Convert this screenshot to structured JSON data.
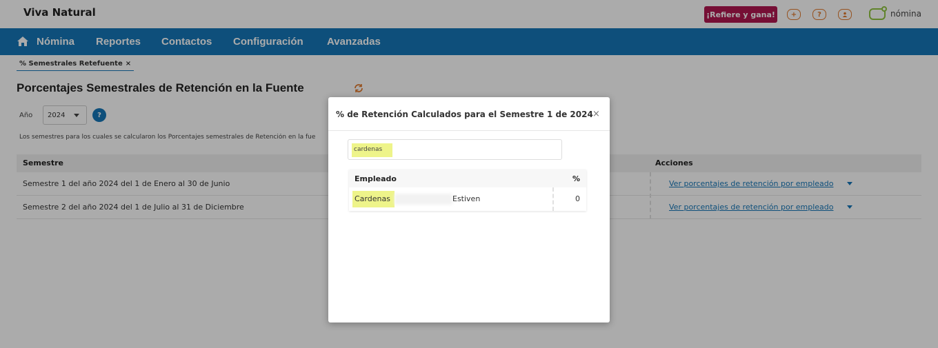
{
  "header": {
    "company": "Viva Natural",
    "refiere_label": "¡Refiere y gana!",
    "icons": [
      "plus-icon",
      "question-icon",
      "user-icon"
    ],
    "logo_text": "nómina"
  },
  "nav": {
    "items": [
      "Nómina",
      "Reportes",
      "Contactos",
      "Configuración",
      "Avanzadas"
    ]
  },
  "tab": {
    "label": "% Semestrales Retefuente",
    "close": "×"
  },
  "page": {
    "title": "Porcentajes Semestrales de Retención en la Fuente",
    "year_label": "Año",
    "year_value": "2024",
    "help": "?",
    "info": "Los semestres para los cuales se calcularon los Porcentajes semestrales de Retención en la fue"
  },
  "table": {
    "headers": {
      "semestre": "Semestre",
      "acciones": "Acciones"
    },
    "rows": [
      {
        "semestre": "Semestre 1 del año 2024 del 1 de Enero al 30 de Junio",
        "accion": "Ver porcentajes de retención por empleado"
      },
      {
        "semestre": "Semestre 2 del año 2024 del 1 de Julio al 31 de Diciembre",
        "accion": "Ver porcentajes de retención por empleado"
      }
    ]
  },
  "modal": {
    "title": "% de Retención Calculados para el Semestre 1 de 2024",
    "close": "×",
    "search_value": "cardenas",
    "headers": {
      "empleado": "Empleado",
      "pct": "%"
    },
    "rows": [
      {
        "empleado_first": "Cardenas",
        "empleado_last": "Estiven",
        "pct": "0"
      }
    ]
  },
  "colors": {
    "nav": "#1677b8",
    "refiere": "#b0174f",
    "icon_accent": "#e07a2e",
    "highlight": "#eef48a",
    "logo": "#8fc43f"
  }
}
